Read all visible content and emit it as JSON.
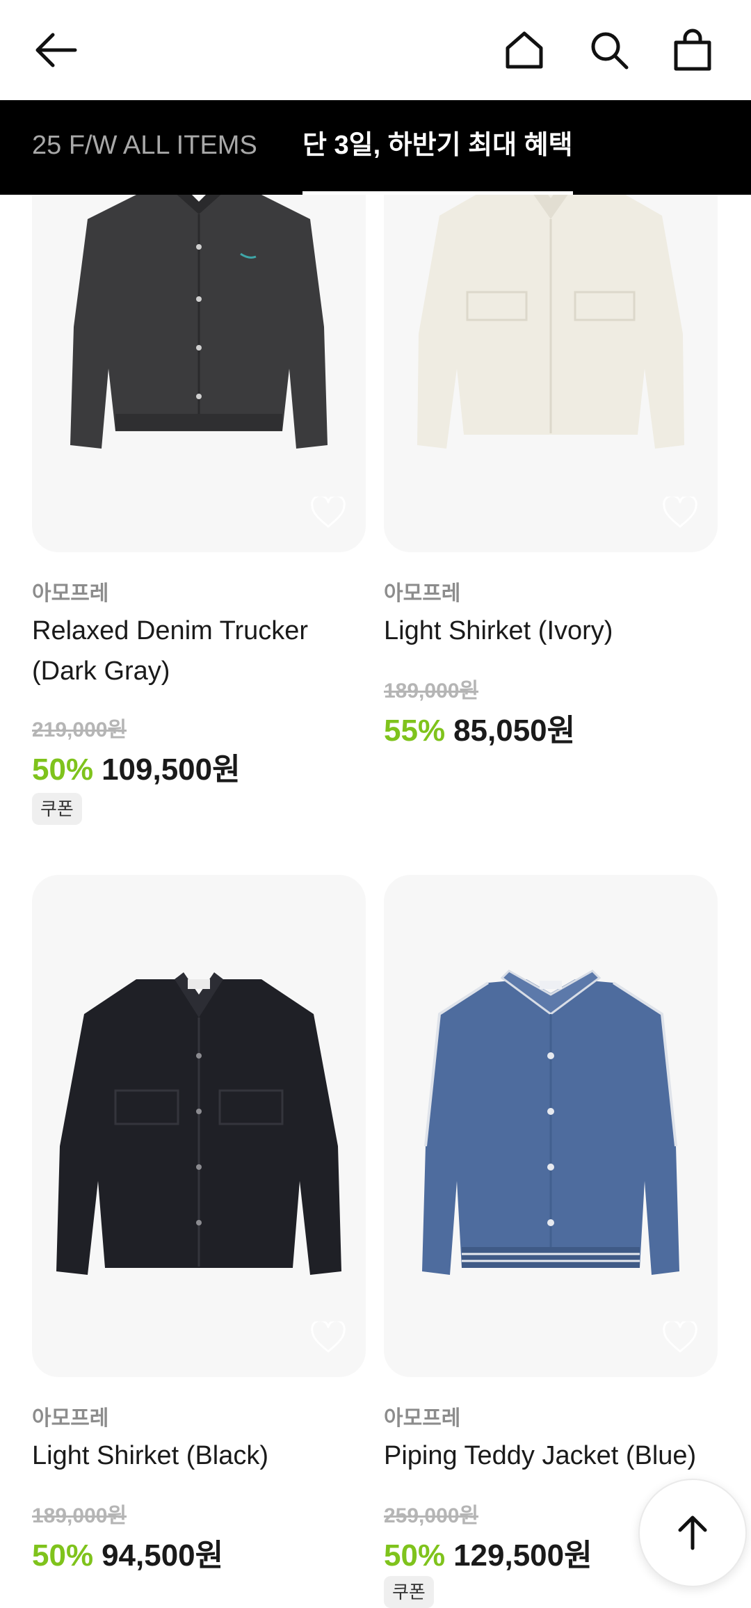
{
  "tabs": [
    {
      "label": "25 F/W ALL ITEMS",
      "active": false
    },
    {
      "label": "단 3일, 하반기 최대 혜택",
      "active": true
    }
  ],
  "products": [
    {
      "brand": "아모프레",
      "name": "Relaxed Denim Trucker (Dark Gray)",
      "original_price": "219,000원",
      "discount": "50%",
      "price": "109,500원",
      "badge": "쿠폰",
      "image": "dark-gray-denim-jacket"
    },
    {
      "brand": "아모프레",
      "name": "Light Shirket (Ivory)",
      "original_price": "189,000원",
      "discount": "55%",
      "price": "85,050원",
      "image": "ivory-shirt-jacket"
    },
    {
      "brand": "아모프레",
      "name": "Light Shirket (Black)",
      "original_price": "189,000원",
      "discount": "50%",
      "price": "94,500원",
      "image": "black-shirt-jacket"
    },
    {
      "brand": "아모프레",
      "name": "Piping Teddy Jacket (Blue)",
      "original_price": "259,000원",
      "discount": "50%",
      "price": "129,500원",
      "badge": "쿠폰",
      "image": "blue-teddy-jacket"
    }
  ],
  "colors": {
    "discount": "#7fc31c",
    "tab_bar": "#000000",
    "card_bg": "#f7f7f7"
  }
}
